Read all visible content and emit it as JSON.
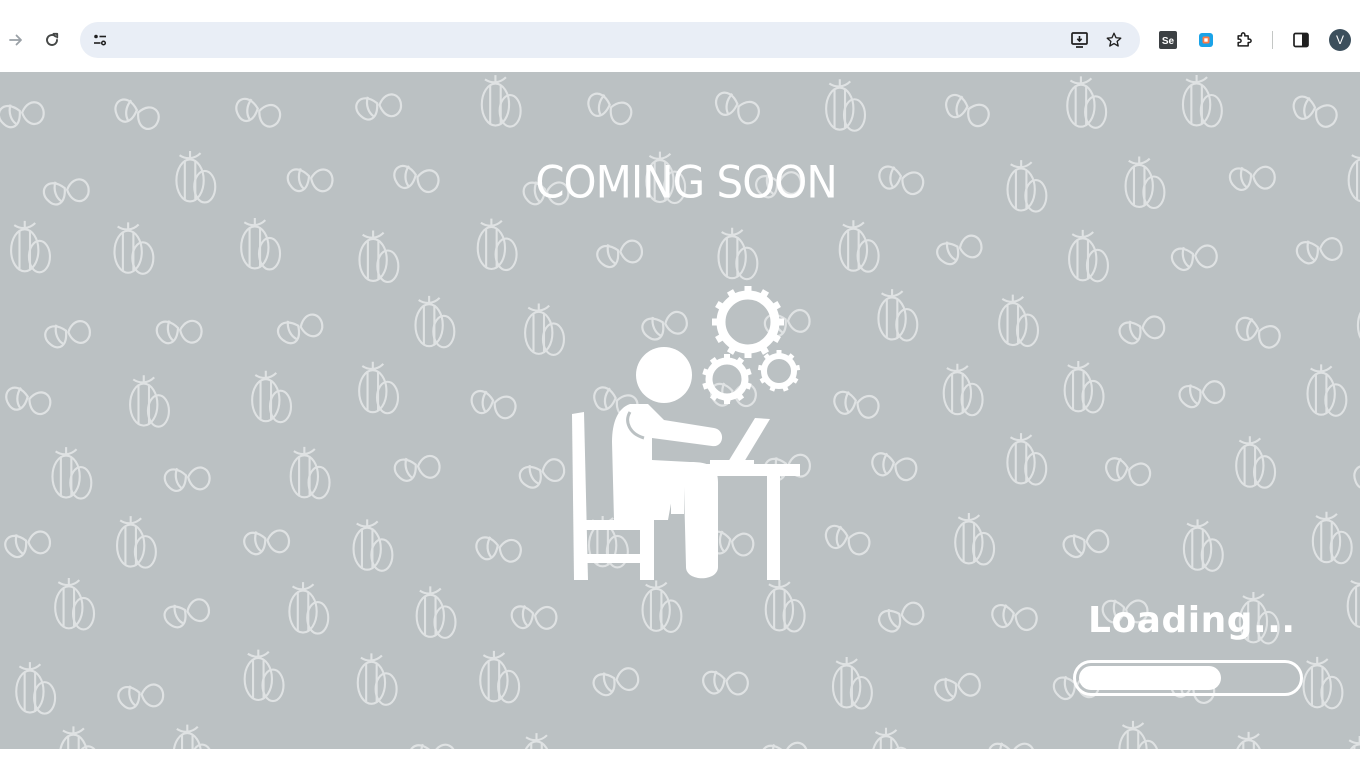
{
  "browser": {
    "nav": {
      "forward_icon": "arrow-right-icon",
      "reload_icon": "reload-icon"
    },
    "omnibox": {
      "site_info_icon": "tune-icon",
      "url": "",
      "install_icon": "install-app-icon",
      "bookmark_icon": "star-icon"
    },
    "extensions": [
      {
        "name": "selenium-extension",
        "label": "Se"
      },
      {
        "name": "color-picker-extension",
        "label": ""
      },
      {
        "name": "extensions-puzzle",
        "label": ""
      }
    ],
    "side_panel_icon": "side-panel-icon",
    "profile_initial": "V"
  },
  "page": {
    "heading": "COMING SOON",
    "loading_text": "Loading...",
    "progress_percent": 65,
    "colors": {
      "background": "#bbc1c3",
      "foreground": "#ffffff",
      "pattern": "#dfe2e3"
    },
    "illustration": "person-working-at-laptop-with-gears"
  }
}
